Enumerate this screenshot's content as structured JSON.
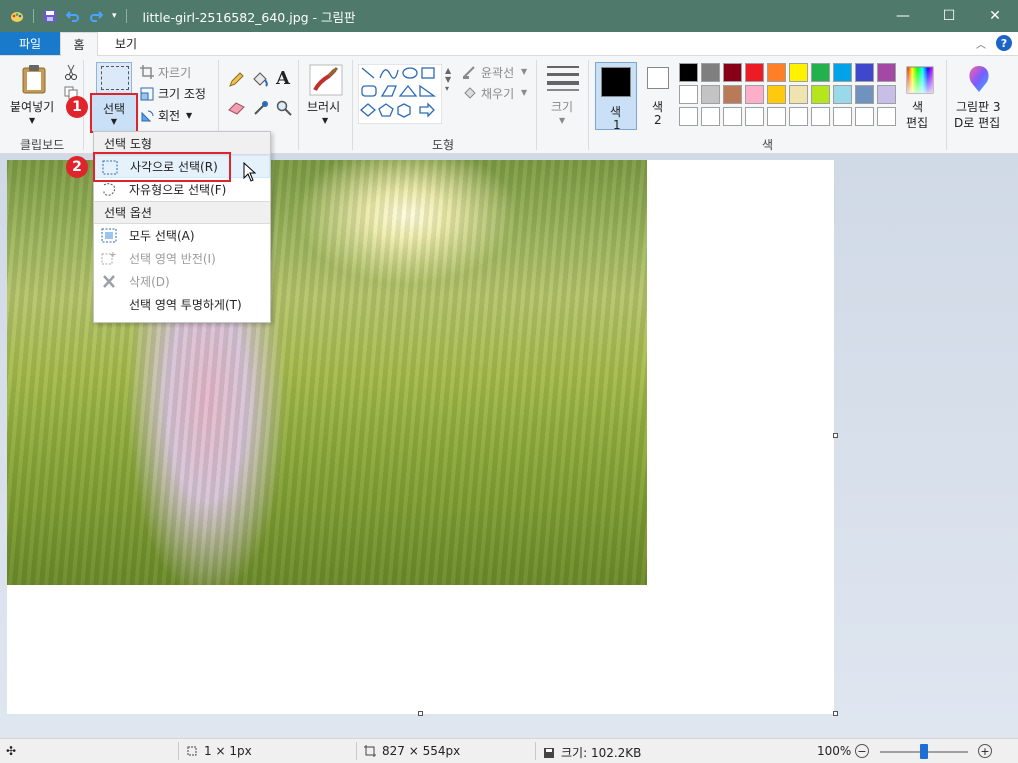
{
  "window": {
    "title": "little-girl-2516582_640.jpg - 그림판",
    "minimize": "—",
    "maximize": "☐",
    "close": "✕"
  },
  "tabs": {
    "file": "파일",
    "home": "홈",
    "view": "보기"
  },
  "ribbon": {
    "clipboard": {
      "paste": "붙여넣기",
      "label": "클립보드"
    },
    "image": {
      "select": "선택",
      "crop": "자르기",
      "resize": "크기 조정",
      "rotate": "회전"
    },
    "brushes": "브러시",
    "shapes": {
      "outline": "윤곽선",
      "fill": "채우기",
      "label": "도형"
    },
    "size": "크기",
    "colors": {
      "color1_a": "색",
      "color1_b": "1",
      "color2_a": "색",
      "color2_b": "2",
      "edit_a": "색",
      "edit_b": "편집",
      "label": "색"
    },
    "paint3d_a": "그림판 3",
    "paint3d_b": "D로 편집",
    "palette": [
      "#000000",
      "#7f7f7f",
      "#880015",
      "#ed1c24",
      "#ff7f27",
      "#fff200",
      "#22b14c",
      "#00a2e8",
      "#3f48cc",
      "#a349a4",
      "#ffffff",
      "#c3c3c3",
      "#b97a57",
      "#ffaec9",
      "#ffc90e",
      "#efe4b0",
      "#b5e61d",
      "#99d9ea",
      "#7092be",
      "#c8bfe7",
      "#ffffff",
      "#ffffff",
      "#ffffff",
      "#ffffff",
      "#ffffff",
      "#ffffff",
      "#ffffff",
      "#ffffff",
      "#ffffff",
      "#ffffff"
    ]
  },
  "menu": {
    "shape_header": "선택 도형",
    "rect_select": "사각으로 선택(R)",
    "free_select": "자유형으로 선택(F)",
    "options_header": "선택 옵션",
    "select_all": "모두 선택(A)",
    "invert": "선택 영역 반전(I)",
    "delete": "삭제(D)",
    "transparent": "선택 영역 투명하게(T)"
  },
  "badges": {
    "one": "1",
    "two": "2"
  },
  "status": {
    "selection": "1 × 1px",
    "dimensions": "827 × 554px",
    "size": "크기: 102.2KB",
    "zoom": "100%"
  }
}
